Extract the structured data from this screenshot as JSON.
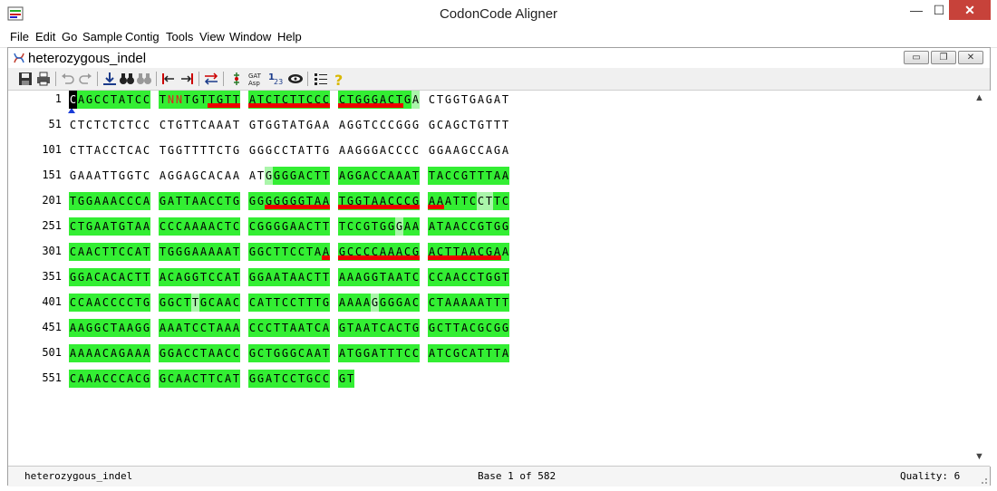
{
  "window": {
    "title": "CodonCode Aligner",
    "minimize": "—",
    "maximize": "☐",
    "close": "✕"
  },
  "menu": [
    "File",
    "Edit",
    "Go",
    "Sample",
    "Contig",
    "Tools",
    "View",
    "Window",
    "Help"
  ],
  "document": {
    "title": "heterozygous_indel",
    "btn_min": "▭",
    "btn_restore": "❐",
    "btn_close": "✕"
  },
  "toolbar": [
    "save-icon",
    "print-icon",
    "undo-icon",
    "redo-icon",
    "download-icon",
    "binoculars-icon",
    "binoculars-gray-icon",
    "trim-left-icon",
    "trim-right-icon",
    "reverse-complement-icon",
    "translate-icon",
    "reading-frame-icon",
    "numbering-icon",
    "hide-icon",
    "alignment-settings-icon",
    "help-icon"
  ],
  "colors": {
    "high_quality": "#33ee33",
    "medium_quality": "#aaf5aa",
    "discrepancy_underline": "#ee0000",
    "cursor": "#000000"
  },
  "sequence": [
    {
      "pos": "1",
      "blocks": [
        "CAGCCTATCC",
        "TNNTGTTGTT",
        "ATCTCTTCCC",
        "CTGGGACTGA",
        "CTGGTGAGAT"
      ]
    },
    {
      "pos": "51",
      "blocks": [
        "CTCTCTCTCC",
        "CTGTTCAAAT",
        "GTGGTATGAA",
        "AGGTCCCGGG",
        "GCAGCTGTTT"
      ]
    },
    {
      "pos": "101",
      "blocks": [
        "CTTACCTCAC",
        "TGGTTTTCTG",
        "GGGCCTATTG",
        "AAGGGACCCC",
        "GGAAGCCAGA"
      ]
    },
    {
      "pos": "151",
      "blocks": [
        "GAAATTGGTC",
        "AGGAGCACAA",
        "ATGGGGACTT",
        "AGGACCAAAT",
        "TACCGTTTAA"
      ]
    },
    {
      "pos": "201",
      "blocks": [
        "TGGAAACCCA",
        "GATTAACCTG",
        "GGGGGGGTAA",
        "TGGTAACCCG",
        "AAATTCCTTC"
      ]
    },
    {
      "pos": "251",
      "blocks": [
        "CTGAATGTAA",
        "CCCAAAACTC",
        "CGGGGAACTT",
        "TCCGTGGGAA",
        "ATAACCGTGG"
      ]
    },
    {
      "pos": "301",
      "blocks": [
        "CAACTTCCAT",
        "TGGGAAAAAT",
        "GGCTTCCTAA",
        "GCCCCAAACG",
        "ACTTAACGAA"
      ]
    },
    {
      "pos": "351",
      "blocks": [
        "GGACACACTT",
        "ACAGGTCCAT",
        "GGAATAACTT",
        "AAAGGTAATC",
        "CCAACCTGGT"
      ]
    },
    {
      "pos": "401",
      "blocks": [
        "CCAACCCCTG",
        "GGCTTGCAAC",
        "CATTCCTTTG",
        "AAAAGGGGAC",
        "CTAAAAATTT"
      ]
    },
    {
      "pos": "451",
      "blocks": [
        "AAGGCTAAGG",
        "AAATCCTAAA",
        "CCCTTAATCA",
        "GTAATCACTG",
        "GCTTACGCGG"
      ]
    },
    {
      "pos": "501",
      "blocks": [
        "AAAACAGAAA",
        "GGACCTAACC",
        "GCTGGGCAAT",
        "ATGGATTTCC",
        "ATCGCATTTA"
      ]
    },
    {
      "pos": "551",
      "blocks": [
        "CAAACCCACG",
        "GCAACTTCAT",
        "GGATCCTGCC",
        "GT"
      ]
    }
  ],
  "status": {
    "name": "heterozygous_indel",
    "base": "Base 1 of 582",
    "quality": "Quality: 6"
  }
}
